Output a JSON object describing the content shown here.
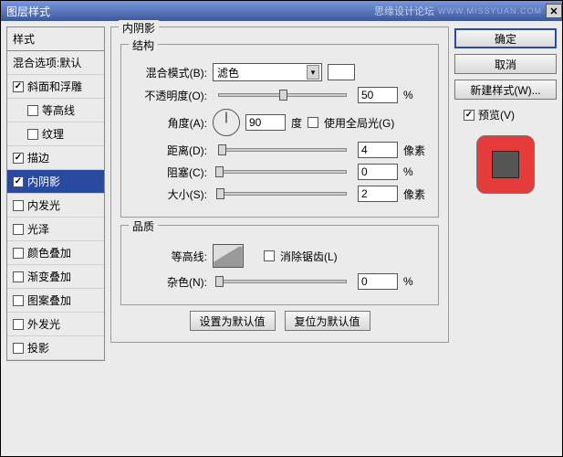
{
  "titlebar": {
    "title": "图层样式",
    "watermark": "思缘设计论坛",
    "watermark2": "WWW.MISSYUAN.COM"
  },
  "left": {
    "header": "样式",
    "items": [
      {
        "label": "混合选项:默认",
        "checkbox": false,
        "checked": false,
        "indent": false,
        "selected": false
      },
      {
        "label": "斜面和浮雕",
        "checkbox": true,
        "checked": true,
        "indent": false,
        "selected": false
      },
      {
        "label": "等高线",
        "checkbox": true,
        "checked": false,
        "indent": true,
        "selected": false
      },
      {
        "label": "纹理",
        "checkbox": true,
        "checked": false,
        "indent": true,
        "selected": false
      },
      {
        "label": "描边",
        "checkbox": true,
        "checked": true,
        "indent": false,
        "selected": false
      },
      {
        "label": "内阴影",
        "checkbox": true,
        "checked": true,
        "indent": false,
        "selected": true
      },
      {
        "label": "内发光",
        "checkbox": true,
        "checked": false,
        "indent": false,
        "selected": false
      },
      {
        "label": "光泽",
        "checkbox": true,
        "checked": false,
        "indent": false,
        "selected": false
      },
      {
        "label": "颜色叠加",
        "checkbox": true,
        "checked": false,
        "indent": false,
        "selected": false
      },
      {
        "label": "渐变叠加",
        "checkbox": true,
        "checked": false,
        "indent": false,
        "selected": false
      },
      {
        "label": "图案叠加",
        "checkbox": true,
        "checked": false,
        "indent": false,
        "selected": false
      },
      {
        "label": "外发光",
        "checkbox": true,
        "checked": false,
        "indent": false,
        "selected": false
      },
      {
        "label": "投影",
        "checkbox": true,
        "checked": false,
        "indent": false,
        "selected": false
      }
    ]
  },
  "center": {
    "panel_title": "内阴影",
    "structure": {
      "legend": "结构",
      "blend_label": "混合模式(B):",
      "blend_value": "滤色",
      "opacity_label": "不透明度(O):",
      "opacity_value": "50",
      "opacity_unit": "%",
      "opacity_pct": 50,
      "angle_label": "角度(A):",
      "angle_value": "90",
      "angle_unit": "度",
      "global_light_label": "使用全局光(G)",
      "global_light_checked": false,
      "distance_label": "距离(D):",
      "distance_value": "4",
      "distance_unit": "像素",
      "distance_pct": 2,
      "choke_label": "阻塞(C):",
      "choke_value": "0",
      "choke_unit": "%",
      "choke_pct": 0,
      "size_label": "大小(S):",
      "size_value": "2",
      "size_unit": "像素",
      "size_pct": 1
    },
    "quality": {
      "legend": "品质",
      "contour_label": "等高线:",
      "antialias_label": "消除锯齿(L)",
      "antialias_checked": false,
      "noise_label": "杂色(N):",
      "noise_value": "0",
      "noise_unit": "%",
      "noise_pct": 0
    },
    "buttons": {
      "make_default": "设置为默认值",
      "reset_default": "复位为默认值"
    }
  },
  "right": {
    "ok": "确定",
    "cancel": "取消",
    "new_style": "新建样式(W)...",
    "preview_label": "预览(V)",
    "preview_checked": true
  }
}
